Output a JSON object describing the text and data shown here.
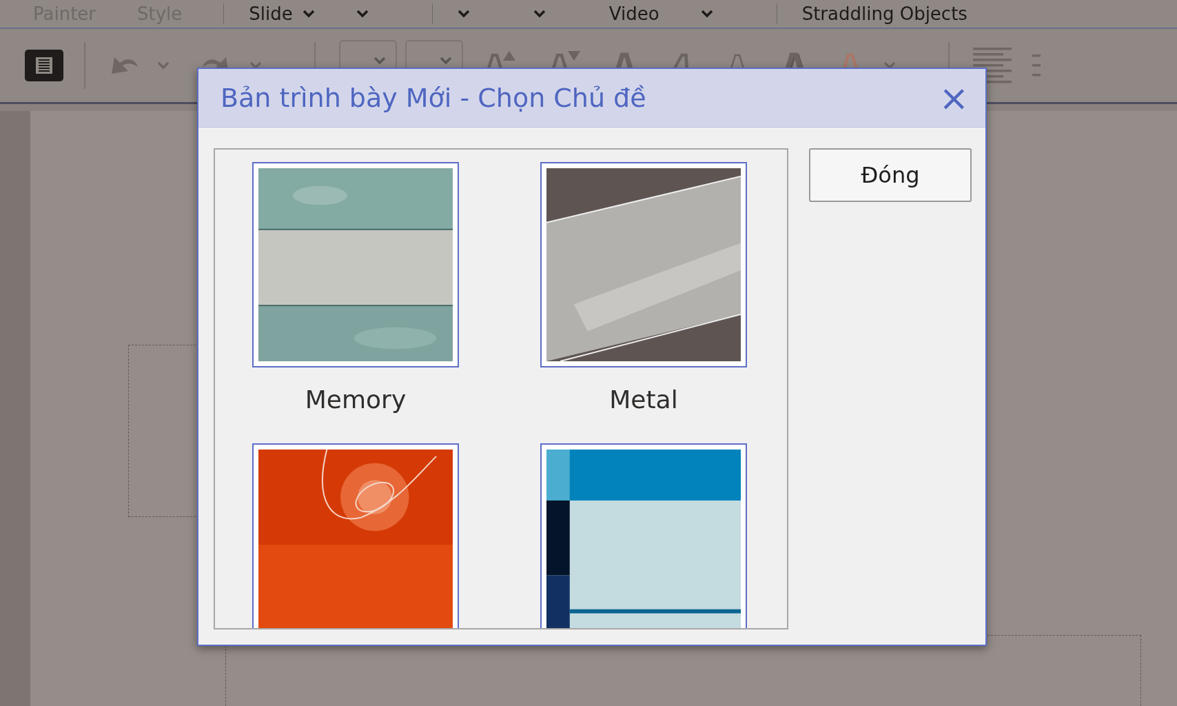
{
  "menu_bar": [
    {
      "kind": "menu",
      "label": "Painter",
      "disabled": true
    },
    {
      "kind": "menu",
      "label": "Style",
      "disabled": true
    },
    {
      "kind": "divider"
    },
    {
      "kind": "menu",
      "label": "Slide",
      "disabled": false,
      "caret": true
    },
    {
      "kind": "caret"
    },
    {
      "kind": "divider"
    },
    {
      "kind": "caret"
    },
    {
      "kind": "caret"
    },
    {
      "kind": "menu",
      "label": "Video",
      "disabled": false,
      "caret": false
    },
    {
      "kind": "caret"
    },
    {
      "kind": "divider"
    },
    {
      "kind": "menu",
      "label": "Straddling Objects",
      "disabled": false,
      "caret": false
    }
  ],
  "toolbar": [
    {
      "kind": "list"
    },
    {
      "kind": "divider"
    },
    {
      "kind": "undo"
    },
    {
      "kind": "caret"
    },
    {
      "kind": "redo"
    },
    {
      "kind": "caret"
    },
    {
      "kind": "divider"
    },
    {
      "kind": "select"
    },
    {
      "kind": "select"
    },
    {
      "kind": "grow"
    },
    {
      "kind": "shrink"
    },
    {
      "kind": "bold"
    },
    {
      "kind": "italic"
    },
    {
      "kind": "thin"
    },
    {
      "kind": "shadow"
    },
    {
      "kind": "color"
    },
    {
      "kind": "caret"
    },
    {
      "kind": "divider"
    },
    {
      "kind": "align"
    },
    {
      "kind": "more"
    }
  ],
  "dialog": {
    "title": "Bản trình bày Mới - Chọn Chủ đề",
    "close": "×",
    "button": "Đóng",
    "themes": [
      {
        "kind": "bands",
        "name": "Memory"
      },
      {
        "kind": "ribbon",
        "name": "Metal"
      },
      {
        "kind": "orbit"
      },
      {
        "kind": "blocks"
      }
    ]
  }
}
